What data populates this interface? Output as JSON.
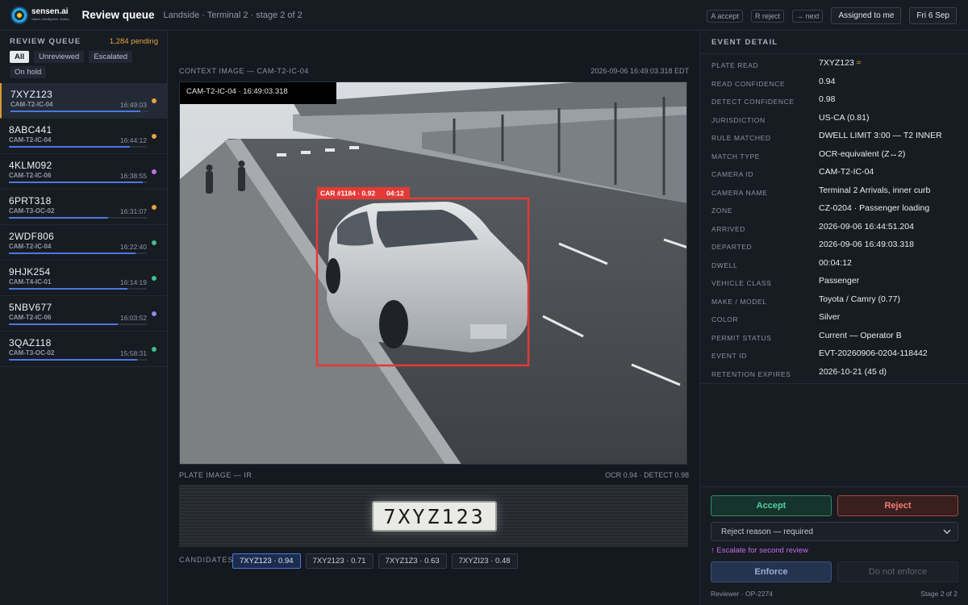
{
  "app": {
    "logo_name": "sensen.ai",
    "logo_tagline": "Vision. Intelligence. Action.",
    "title": "Review queue",
    "breadcrumb": "Landside · Terminal 2 · stage 2 of 2",
    "hints": [
      "A accept",
      "R reject",
      "→ next"
    ],
    "assigned_label": "Assigned to me",
    "date_label": "Fri 6 Sep"
  },
  "sidebar": {
    "title": "REVIEW QUEUE",
    "pending": "1,284 pending",
    "filters": [
      "All",
      "Unreviewed",
      "Escalated",
      "On hold"
    ],
    "items": [
      {
        "plate": "7XYZ123",
        "camera": "CAM-T2-IC-04",
        "time": "16:49:03",
        "dot_color": "#e8a33c",
        "progress": 0.94
      },
      {
        "plate": "8ABC441",
        "camera": "CAM-T2-IC-04",
        "time": "16:44:12",
        "dot_color": "#e8a33c",
        "progress": 0.88
      },
      {
        "plate": "4KLM092",
        "camera": "CAM-T2-IC-06",
        "time": "16:38:55",
        "dot_color": "#c36df0",
        "progress": 0.97
      },
      {
        "plate": "6PRT318",
        "camera": "CAM-T3-OC-02",
        "time": "16:31:07",
        "dot_color": "#e8a33c",
        "progress": 0.72
      },
      {
        "plate": "2WDF806",
        "camera": "CAM-T2-IC-04",
        "time": "16:22:40",
        "dot_color": "#3fbf8a",
        "progress": 0.92
      },
      {
        "plate": "9HJK254",
        "camera": "CAM-T4-IC-01",
        "time": "16:14:19",
        "dot_color": "#3fbf8a",
        "progress": 0.86
      },
      {
        "plate": "5NBV677",
        "camera": "CAM-T2-IC-06",
        "time": "16:03:52",
        "dot_color": "#8d8ce6",
        "progress": 0.79
      },
      {
        "plate": "3QAZ118",
        "camera": "CAM-T3-OC-02",
        "time": "15:58:31",
        "dot_color": "#3fbf8a",
        "progress": 0.93
      }
    ]
  },
  "main": {
    "context_label": "CONTEXT IMAGE — CAM-T2-IC-04",
    "context_timestamp": "2026-09-06 16:49:03.318 EDT",
    "camera_overlay": "CAM-T2-IC-04 · 16:49:03.318",
    "detection_label": "CAR #1184 · 0.92",
    "detection_dwell": "04:12",
    "plate_label": "PLATE IMAGE — IR",
    "plate_scores": "OCR 0.94 · DETECT 0.98",
    "plate_text": "7XYZ123",
    "candidates_label": "CANDIDATES",
    "candidates": [
      "7XYZ123 · 0.94",
      "7XY2123 · 0.71",
      "7XYZ1Z3 · 0.63",
      "7XYZI23 · 0.48"
    ]
  },
  "detail": {
    "title": "EVENT DETAIL",
    "rows": [
      {
        "label": "Plate read",
        "value": "7XYZ123"
      },
      {
        "label": "Read confidence",
        "value": "0.94"
      },
      {
        "label": "Detect confidence",
        "value": "0.98"
      },
      {
        "label": "Jurisdiction",
        "value": "US-CA  (0.81)"
      },
      {
        "label": "Rule matched",
        "value": "DWELL LIMIT 3:00 — T2 INNER"
      },
      {
        "label": "Match type",
        "value": "OCR-equivalent (Z↔2)"
      },
      {
        "label": "Camera ID",
        "value": "CAM-T2-IC-04"
      },
      {
        "label": "Camera name",
        "value": "Terminal 2 Arrivals, inner curb"
      },
      {
        "label": "Zone",
        "value": "CZ-0204 · Passenger loading"
      },
      {
        "label": "Arrived",
        "value": "2026-09-06 16:44:51.204"
      },
      {
        "label": "Departed",
        "value": "2026-09-06 16:49:03.318"
      },
      {
        "label": "Dwell",
        "value": "00:04:12"
      },
      {
        "label": "Vehicle class",
        "value": "Passenger"
      },
      {
        "label": "Make / model",
        "value": "Toyota / Camry  (0.77)"
      },
      {
        "label": "Color",
        "value": "Silver"
      },
      {
        "label": "Permit status",
        "value": "Current — Operator B"
      },
      {
        "label": "Event ID",
        "value": "EVT-20260906-0204-118442"
      },
      {
        "label": "Retention expires",
        "value": "2026-10-21  (45 d)"
      }
    ],
    "approx_symbol": "≈",
    "accept_label": "Accept",
    "reject_label": "Reject",
    "reason_placeholder": "Reject reason — required",
    "escalate_label": "↑ Escalate for second review",
    "enforce_label": "Enforce",
    "no_enforce_label": "Do not enforce",
    "reviewer": "Reviewer · OP-2274",
    "stage": "Stage 2 of 2"
  },
  "colors": {
    "accent_amber": "#e8a33c",
    "accept_green": "#4ed1a2",
    "reject_red": "#f07f72",
    "escalate_purple": "#c36df0",
    "detection_red": "#e53935",
    "progress_blue": "#4a78e0"
  }
}
